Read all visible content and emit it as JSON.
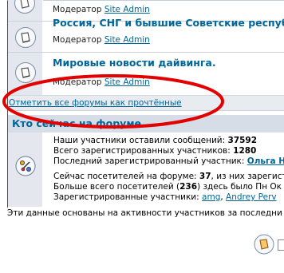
{
  "forums": [
    {
      "title": "",
      "moderator_prefix": "Модератор",
      "moderator_name": "Site Admin"
    },
    {
      "title": "Россия, СНГ и бывшие Советские республ",
      "moderator_prefix": "Модератор",
      "moderator_name": "Site Admin"
    },
    {
      "title": "Мировые новости дайвинга.",
      "moderator_prefix": "Модератор",
      "moderator_name": "Site Admin"
    }
  ],
  "mark_read_link": "Отметить все форумы как прочтённые",
  "whos_online": {
    "title": "Кто сейчас на форуме",
    "posts_label": "Наши участники оставили сообщений:",
    "posts_value": "37592",
    "users_label": "Всего зарегистрированных участников:",
    "users_value": "1280",
    "newest_label": "Последний зарегистрированный участник:",
    "newest_user": "Ольга Н",
    "online_label": "Сейчас посетителей на форуме:",
    "online_value": "37",
    "online_rest": ", из них зарегист",
    "record_label": "Больше всего посетителей (",
    "record_value": "236",
    "record_rest": ") здесь было Пн Ок",
    "registered_label": "Зарегистрированные участники:",
    "registered_users": [
      "amg",
      "Andrey Perv"
    ]
  },
  "footnote": "Эти данные основаны на активности участников за последни",
  "colors": {
    "link": "#006699",
    "row_bg": "#e4e8ee",
    "annotation": "#e30000"
  }
}
